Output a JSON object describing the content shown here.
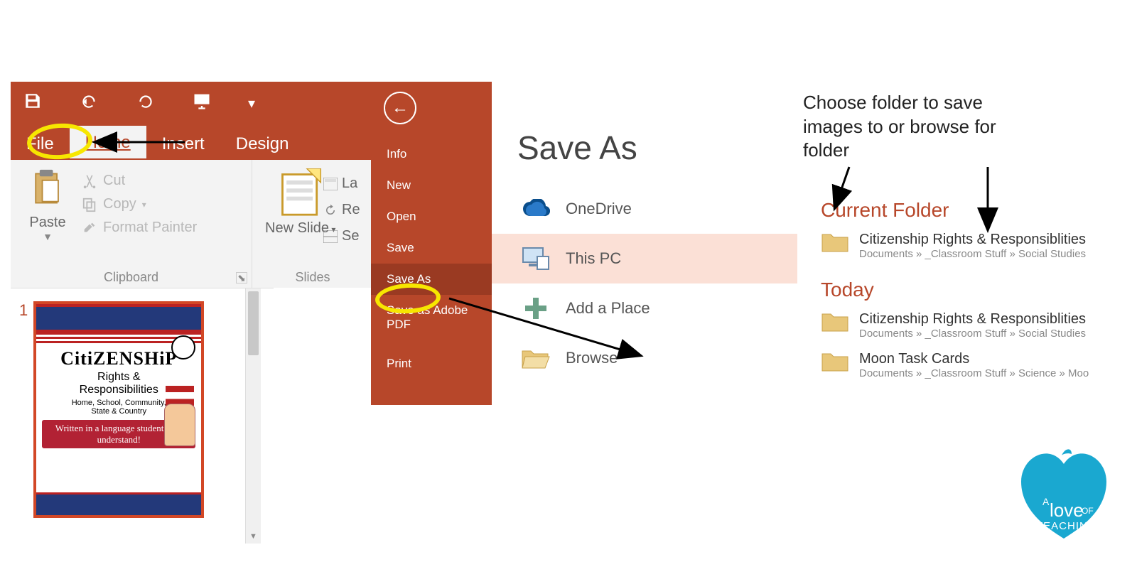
{
  "ribbon": {
    "tabs": {
      "file": "File",
      "home": "Home",
      "insert": "Insert",
      "design": "Design"
    },
    "clipboard": {
      "paste": "Paste",
      "cut": "Cut",
      "copy": "Copy",
      "format_painter": "Format Painter",
      "caption": "Clipboard"
    },
    "slides": {
      "new_slide": "New Slide",
      "layout_trunc": "La",
      "reset_trunc": "Re",
      "section_trunc": "Se",
      "caption": "Slides"
    }
  },
  "slidepane": {
    "num": "1",
    "thumb": {
      "title": "CitiZENSHiP",
      "sub1a": "Rights &",
      "sub1b": "Responsibilities",
      "sub2a": "Home, School, Community,",
      "sub2b": "State & Country",
      "band": "Written in a language students can understand!"
    }
  },
  "backstage": {
    "items": [
      "Info",
      "New",
      "Open",
      "Save",
      "Save As",
      "Save as Adobe PDF",
      "Print"
    ],
    "selected_index": 4
  },
  "saveas": {
    "title": "Save As",
    "locations": [
      {
        "label": "OneDrive",
        "icon": "cloud"
      },
      {
        "label": "This PC",
        "icon": "pc"
      },
      {
        "label": "Add a Place",
        "icon": "plus"
      },
      {
        "label": "Browse",
        "icon": "folder-open"
      }
    ],
    "selected_index": 1
  },
  "folders": {
    "current_heading": "Current Folder",
    "today_heading": "Today",
    "current": [
      {
        "name": "Citizenship Rights & Responsiblities",
        "path": "Documents » _Classroom Stuff » Social Studies"
      }
    ],
    "today": [
      {
        "name": "Citizenship Rights & Responsiblities",
        "path": "Documents » _Classroom Stuff » Social Studies"
      },
      {
        "name": "Moon Task Cards",
        "path": "Documents » _Classroom Stuff » Science » Moo"
      }
    ]
  },
  "annotation": {
    "line1": "Choose folder to save",
    "line2": "images to or browse for",
    "line3": "folder"
  },
  "logo": {
    "line1": "A",
    "line2": "love",
    "line3": "OF",
    "line4": "TEACHING"
  }
}
